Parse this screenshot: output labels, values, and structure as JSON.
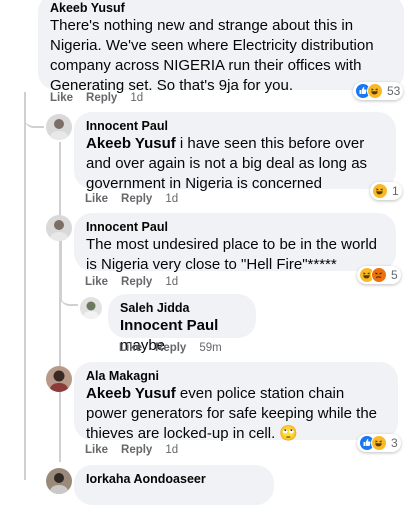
{
  "comments": [
    {
      "author": "Akeeb Yusuf",
      "mention": "",
      "text": "There's nothing new and strange about this in Nigeria. We've seen where Electricity distribution company across NIGERIA run their offices with Generating set. So that's 9ja for you.",
      "like": "Like",
      "reply": "Reply",
      "time": "1d",
      "reaction_count": "53"
    },
    {
      "author": "Innocent Paul",
      "mention": "Akeeb Yusuf",
      "text": " i have seen this before over and over again is not a big deal as long as government in Nigeria is concerned",
      "like": "Like",
      "reply": "Reply",
      "time": "1d",
      "reaction_count": "1"
    },
    {
      "author": "Innocent Paul",
      "mention": "",
      "text": "The most undesired place to be in the world is Nigeria very close to \"Hell Fire\"*****",
      "like": "Like",
      "reply": "Reply",
      "time": "1d",
      "reaction_count": "5"
    },
    {
      "author": "Saleh Jidda",
      "mention": "Innocent Paul",
      "text": " maybe",
      "like": "Like",
      "reply": "Reply",
      "time": "59m"
    },
    {
      "author": "Ala Makagni",
      "mention": "Akeeb Yusuf",
      "text": " even police station chain power generators for safe keeping while the thieves are locked-up in cell. 🙄",
      "like": "Like",
      "reply": "Reply",
      "time": "1d",
      "reaction_count": "3"
    },
    {
      "author": "Iorkaha Aondoaseer"
    }
  ],
  "icons": {
    "like": "like-reaction-icon",
    "haha": "haha-reaction-icon",
    "angry": "angry-reaction-icon"
  },
  "colors": {
    "bubble": "#f0f2f5",
    "meta": "#65676b",
    "like_blue": "#1877f2",
    "haha_yellow": "#f7b928",
    "angry_orange": "#e9710f"
  }
}
